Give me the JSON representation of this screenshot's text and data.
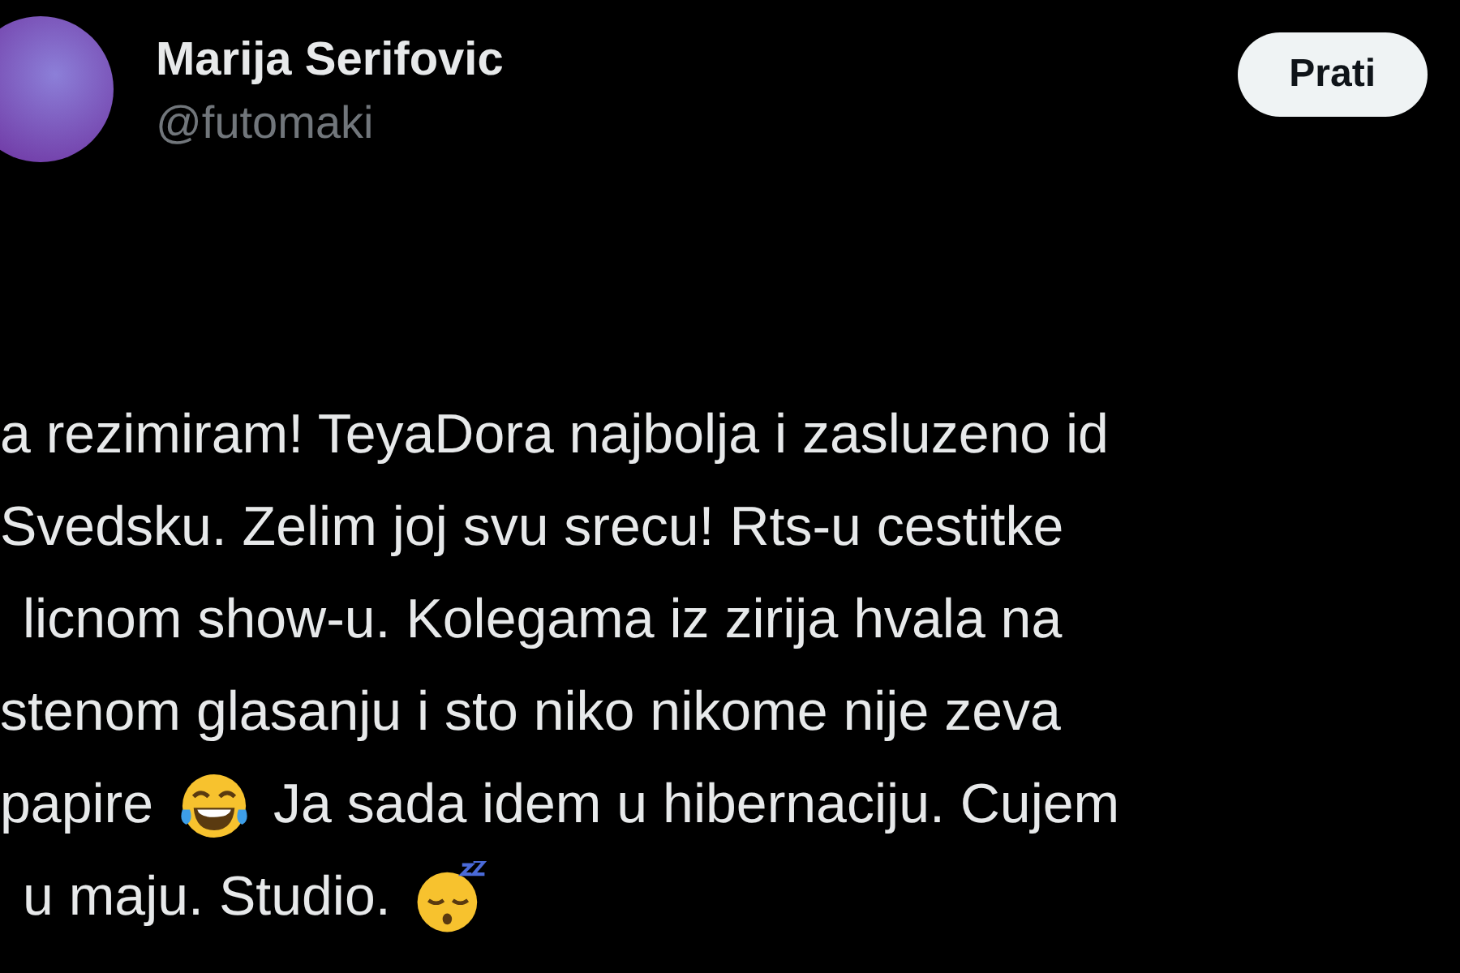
{
  "author": {
    "name": "Marija Serifovic",
    "handle": "@futomaki"
  },
  "follow_button": {
    "label": "Prati"
  },
  "tweet_lines": [
    [
      {
        "kind": "text",
        "text": "a rezimiram! TeyaDora najbolja i zasluzeno id"
      }
    ],
    [
      {
        "kind": "text",
        "text": "Svedsku. Zelim joj svu srecu! Rts-u cestitke"
      }
    ],
    [
      {
        "kind": "text",
        "text": "licnom show-u. Kolegama iz zirija hvala na"
      }
    ],
    [
      {
        "kind": "text",
        "text": "stenom glasanju i sto niko nikome nije zeva"
      }
    ],
    [
      {
        "kind": "text",
        "text": "papire"
      },
      {
        "kind": "laugh"
      },
      {
        "kind": "text",
        "text": "Ja sada idem u hibernaciju. Cujem"
      }
    ],
    [
      {
        "kind": "text",
        "text": "u maju. Studio."
      },
      {
        "kind": "sleep"
      }
    ]
  ]
}
